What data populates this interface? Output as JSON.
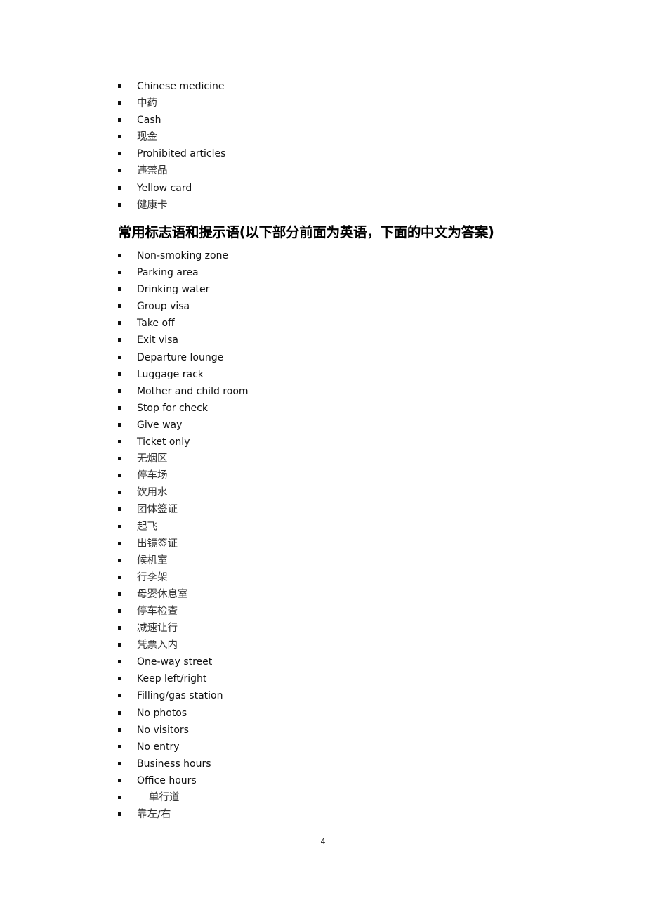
{
  "list1": [
    {
      "text": "Chinese medicine",
      "lang": "en"
    },
    {
      "text": "中药",
      "lang": "zh"
    },
    {
      "text": "Cash",
      "lang": "en"
    },
    {
      "text": "现金",
      "lang": "zh"
    },
    {
      "text": "Prohibited articles",
      "lang": "en"
    },
    {
      "text": "违禁品",
      "lang": "zh"
    },
    {
      "text": "Yellow card",
      "lang": "en"
    },
    {
      "text": "健康卡",
      "lang": "zh"
    }
  ],
  "heading": "常用标志语和提示语(以下部分前面为英语，下面的中文为答案)",
  "list2": [
    {
      "text": "Non-smoking zone",
      "lang": "en"
    },
    {
      "text": "Parking area",
      "lang": "en"
    },
    {
      "text": "Drinking water",
      "lang": "en"
    },
    {
      "text": "Group visa",
      "lang": "en"
    },
    {
      "text": "Take off",
      "lang": "en"
    },
    {
      "text": "Exit visa",
      "lang": "en"
    },
    {
      "text": "Departure lounge",
      "lang": "en"
    },
    {
      "text": "Luggage rack",
      "lang": "en"
    },
    {
      "text": "Mother and child room",
      "lang": "en"
    },
    {
      "text": "Stop for check",
      "lang": "en"
    },
    {
      "text": "Give way",
      "lang": "en"
    },
    {
      "text": "Ticket only",
      "lang": "en"
    },
    {
      "text": "无烟区",
      "lang": "zh"
    },
    {
      "text": "停车场",
      "lang": "zh"
    },
    {
      "text": "饮用水",
      "lang": "zh"
    },
    {
      "text": "团体签证",
      "lang": "zh"
    },
    {
      "text": "起飞",
      "lang": "zh"
    },
    {
      "text": "出镜签证",
      "lang": "zh"
    },
    {
      "text": "候机室",
      "lang": "zh"
    },
    {
      "text": "行李架",
      "lang": "zh"
    },
    {
      "text": "母婴休息室",
      "lang": "zh"
    },
    {
      "text": "停车检查",
      "lang": "zh"
    },
    {
      "text": "减速让行",
      "lang": "zh"
    },
    {
      "text": "凭票入内",
      "lang": "zh"
    },
    {
      "text": "One-way street",
      "lang": "en"
    },
    {
      "text": "Keep left/right",
      "lang": "en"
    },
    {
      "text": "Filling/gas station",
      "lang": "en"
    },
    {
      "text": "No photos",
      "lang": "en"
    },
    {
      "text": "No visitors",
      "lang": "en"
    },
    {
      "text": "No entry",
      "lang": "en"
    },
    {
      "text": "Business hours",
      "lang": "en"
    },
    {
      "text": "Office hours",
      "lang": "en"
    },
    {
      "text": "单行道",
      "lang": "zh",
      "indent": true
    },
    {
      "text": "靠左/右",
      "lang": "zh"
    }
  ],
  "page_number": "4"
}
